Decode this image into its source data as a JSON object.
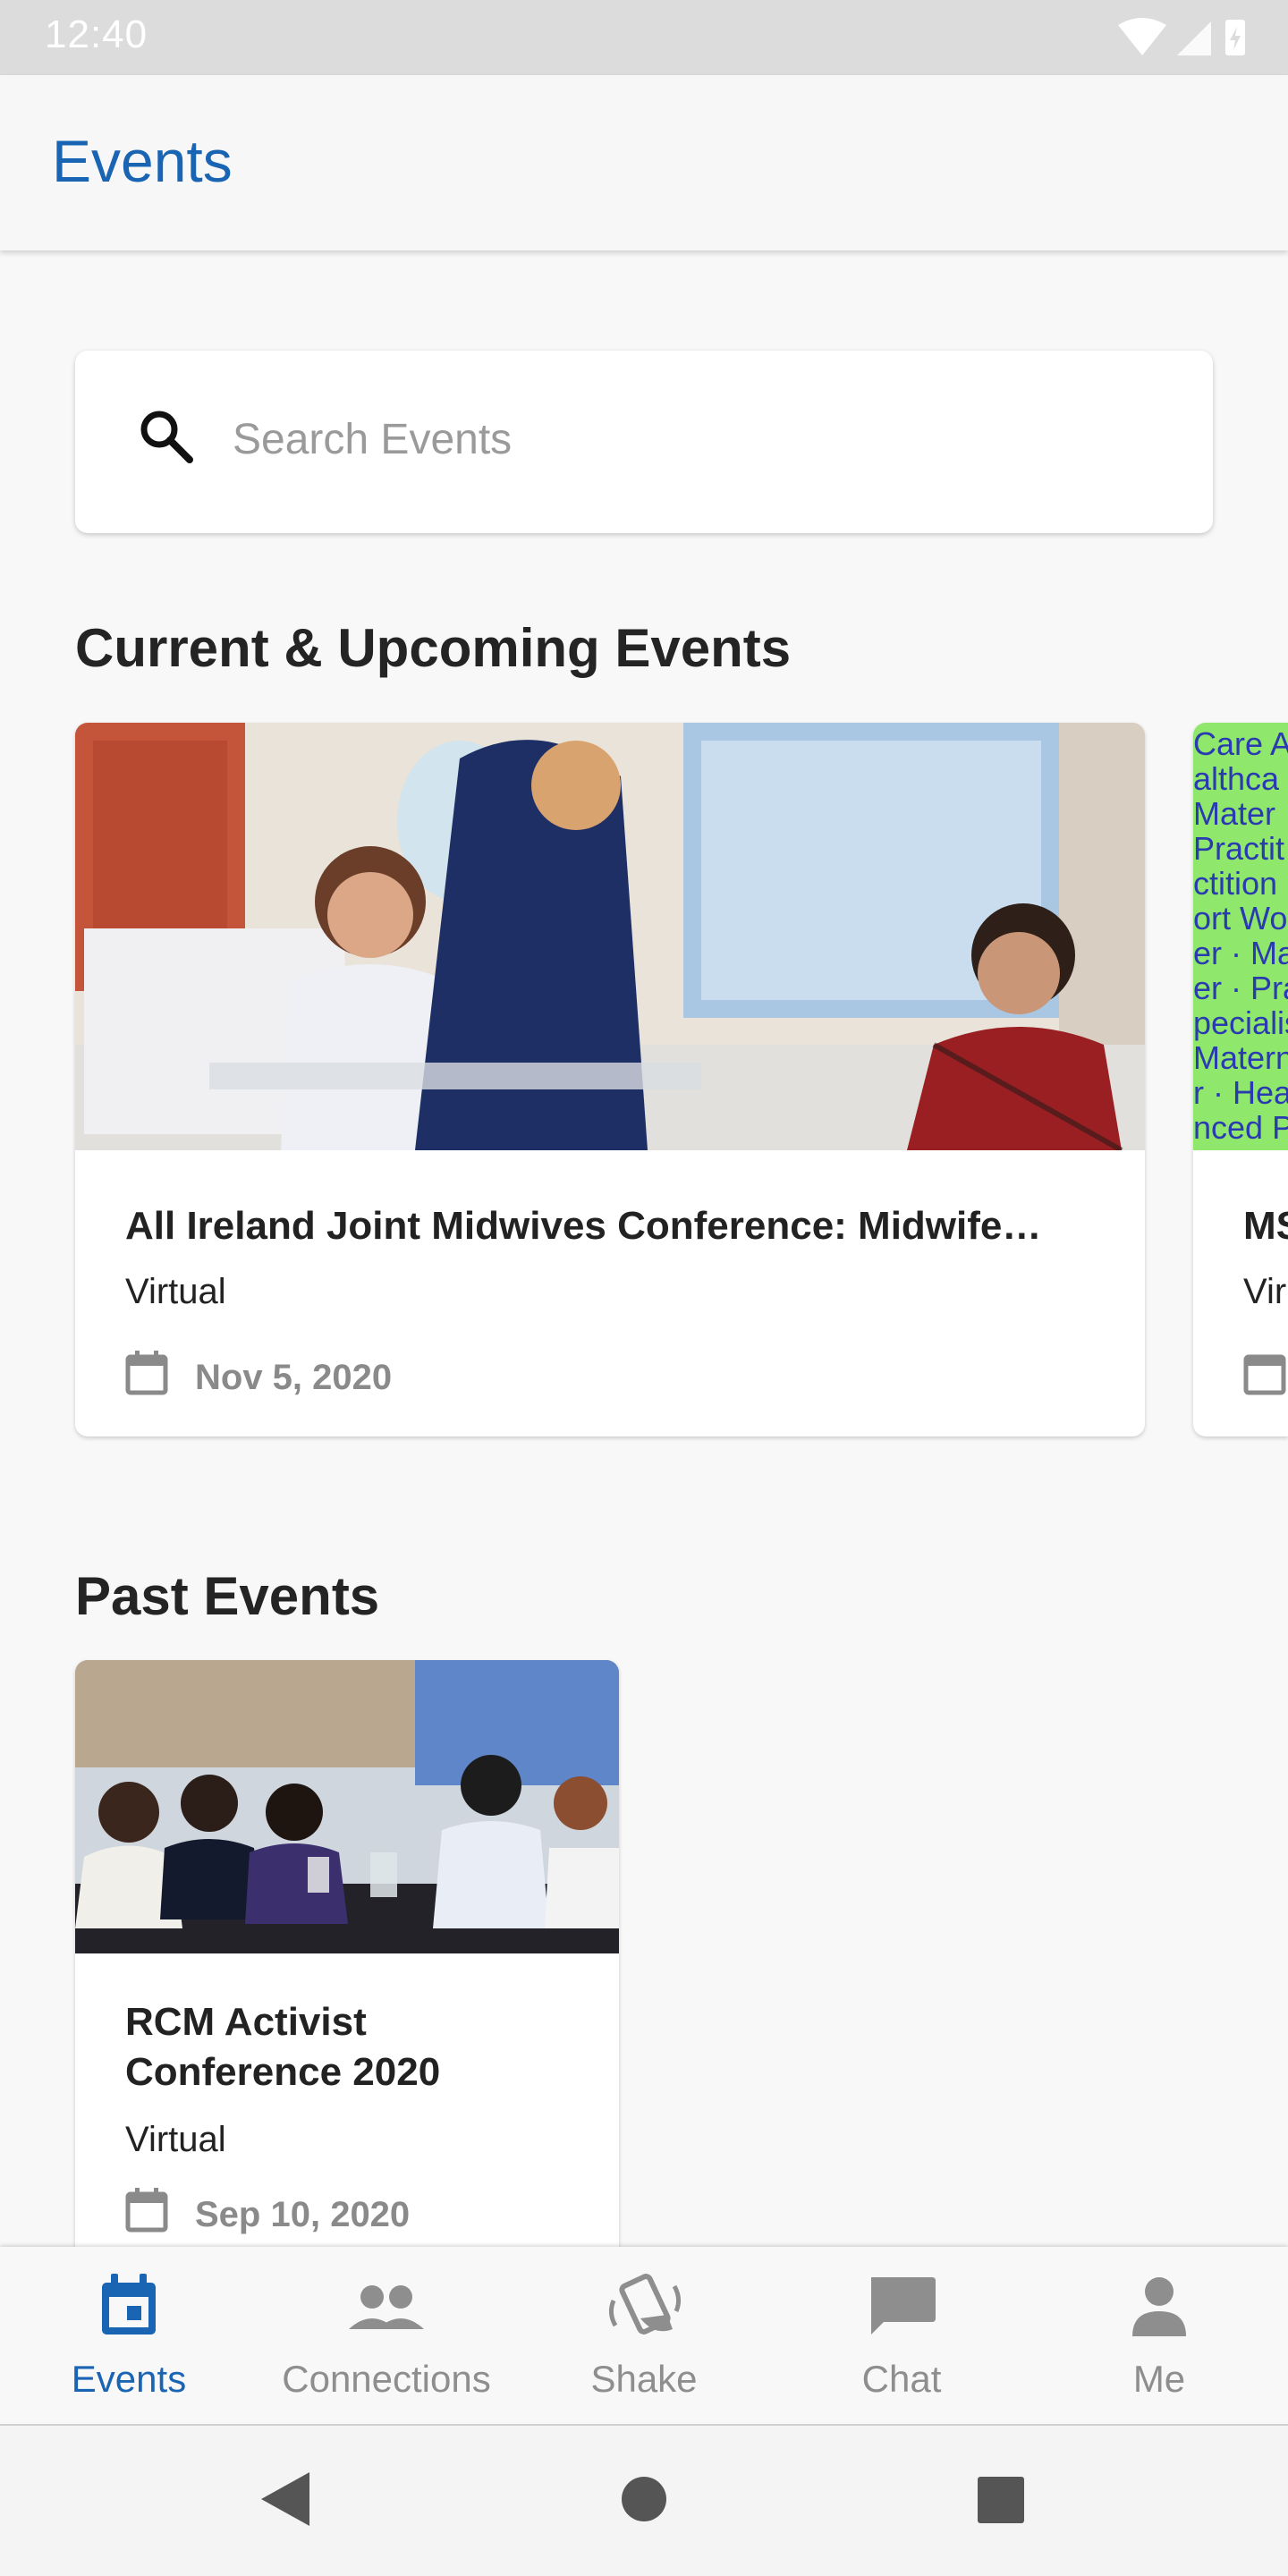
{
  "status_bar": {
    "time": "12:40"
  },
  "header": {
    "title": "Events"
  },
  "search": {
    "placeholder": "Search Events"
  },
  "sections": {
    "current": {
      "title": "Current & Upcoming Events"
    },
    "past": {
      "title": "Past Events"
    }
  },
  "current_events": [
    {
      "title": "All Ireland Joint Midwives Conference: Midwife…",
      "location": "Virtual",
      "date": "Nov 5, 2020"
    },
    {
      "title": "MS",
      "location": "Vir",
      "date": ""
    }
  ],
  "past_events": [
    {
      "title_line1": "RCM Activist",
      "title_line2": "Conference 2020",
      "location": "Virtual",
      "date": "Sep 10, 2020"
    }
  ],
  "poster_words": [
    "Care A",
    "althca",
    "Mater",
    "Practit",
    "ctition",
    "ort Wor",
    "er · Ma",
    "er · Pra",
    "pecialis",
    "Matern",
    "r · Hea",
    "nced P"
  ],
  "bottom_nav": [
    {
      "label": "Events",
      "active": true
    },
    {
      "label": "Connections",
      "active": false
    },
    {
      "label": "Shake",
      "active": false
    },
    {
      "label": "Chat",
      "active": false
    },
    {
      "label": "Me",
      "active": false
    }
  ],
  "colors": {
    "accent": "#1a64b4",
    "inactive": "#8e8e8e",
    "poster_bg": "#8fe86c"
  }
}
